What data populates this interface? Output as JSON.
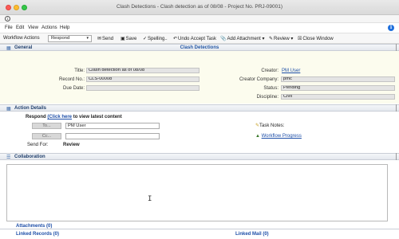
{
  "window": {
    "title": "Clash Detections - Clash detection as of 08/08 - Project No. PRJ-09001)"
  },
  "menu": {
    "items": [
      "File",
      "Edit",
      "View",
      "Actions",
      "Help"
    ],
    "help_badge": "i",
    "info_icon": "i"
  },
  "toolbar": {
    "workflow_actions_label": "Workflow Actions",
    "workflow_select_value": "Respond",
    "send": "Send",
    "save": "Save",
    "spelling": "Spelling..",
    "undo_accept": "Undo Accept Task",
    "add_attachment": "Add Attachment",
    "review": "Review",
    "close_window": "Close Window"
  },
  "general": {
    "section_label": "General",
    "header_center": "Clash Detections",
    "title_label": "Title:",
    "title_value": "Clash detection as of 08/08",
    "record_label": "Record No.:",
    "record_value": "CLS-00008",
    "due_label": "Due Date:",
    "due_value": "",
    "creator_label": "Creator:",
    "creator_value": "PM User",
    "creator_company_label": "Creator Company:",
    "creator_company_value": "pmc",
    "status_label": "Status:",
    "status_value": "Pending",
    "discipline_label": "Discipline:",
    "discipline_value": "Civil"
  },
  "action_details": {
    "section_label": "Action Details",
    "respond_prefix": "Respond",
    "respond_link": "(Click here",
    "respond_suffix": "to view latest content",
    "to_button": "To...",
    "to_value": "PM User",
    "cc_button": "Cc...",
    "cc_value": "",
    "send_for_label": "Send For:",
    "send_for_value": "Review",
    "task_notes": "Task Notes:",
    "workflow_progress": "Workflow Progress"
  },
  "collaboration": {
    "section_label": "Collaboration"
  },
  "footer": {
    "attachments": "Attachments (0)",
    "linked_records": "Linked Records (0)",
    "linked_mail": "Linked Mail (0)"
  },
  "colors": {
    "accent": "#1d4ea8",
    "general_bg": "#fcfcee",
    "help_badge": "#1e6fdc"
  }
}
